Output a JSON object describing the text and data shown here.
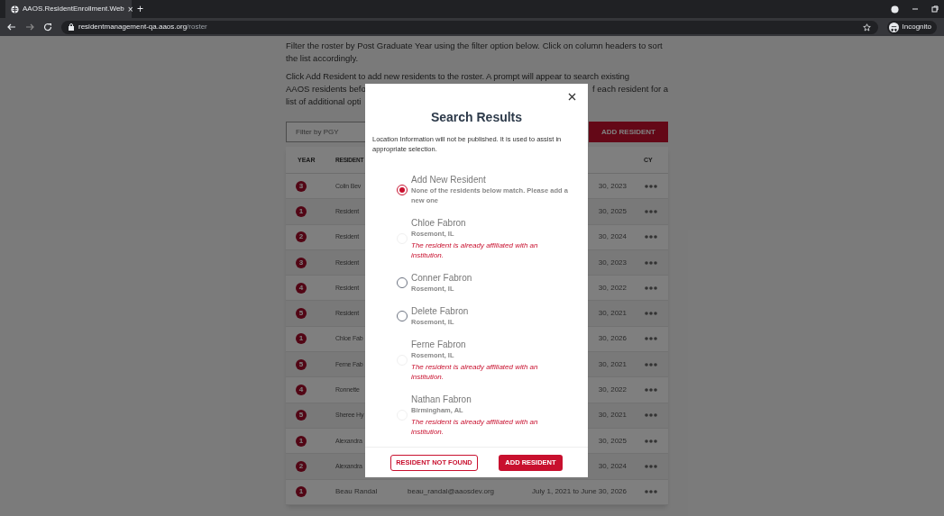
{
  "browser": {
    "tab_title": "AAOS.ResidentEnrollment.Web",
    "tab_close": "×",
    "new_tab": "+",
    "url_host": "residentmanagement-qa.aaos.org",
    "url_path": "/roster",
    "profile": "Incognito"
  },
  "intro": [
    "Filter the roster by Post Graduate Year using the filter option below. Click on column headers to sort the list accordingly.",
    "Click Add Resident to add new residents to the roster. A prompt will appear to search existing"
  ],
  "intro_cut": [
    {
      "left": "AAOS residents befo",
      "right": "f each resident for a"
    },
    {
      "left": "list of additional opti"
    }
  ],
  "filter": {
    "placeholder": "Filter by PGY"
  },
  "add_button": "ADD RESIDENT",
  "table": {
    "columns": [
      "YEAR",
      "RESIDENT",
      "CY"
    ],
    "rows": [
      {
        "year": "3",
        "name": "Colin Bev",
        "dates": "30, 2023"
      },
      {
        "year": "1",
        "name": "Resident",
        "dates": "30, 2025"
      },
      {
        "year": "2",
        "name": "Resident",
        "dates": "30, 2024"
      },
      {
        "year": "3",
        "name": "Resident",
        "dates": "30, 2023"
      },
      {
        "year": "4",
        "name": "Resident",
        "dates": "30, 2022"
      },
      {
        "year": "5",
        "name": "Resident",
        "dates": "30, 2021"
      },
      {
        "year": "1",
        "name": "Chloe Fab",
        "dates": "30, 2026"
      },
      {
        "year": "5",
        "name": "Ferne Fab",
        "dates": "30, 2021"
      },
      {
        "year": "4",
        "name": "Ronnette",
        "dates": "30, 2022"
      },
      {
        "year": "5",
        "name": "Sheree Hy",
        "dates": "30, 2021"
      },
      {
        "year": "1",
        "name": "Alexandra",
        "dates": "30, 2025"
      },
      {
        "year": "2",
        "name": "Alexandra",
        "dates": "30, 2024"
      },
      {
        "year": "1",
        "name": "Beau Randal",
        "email": "beau_randal@aaosdev.org",
        "dates": "July 1, 2021 to June 30, 2026"
      }
    ]
  },
  "modal": {
    "title": "Search Results",
    "info": "Location Information will not be published. It is used to assist in appropriate selection.",
    "options": [
      {
        "name": "Add New Resident",
        "detail": "None of the residents below match. Please add a new one",
        "selected": true,
        "disabled": false
      },
      {
        "name": "Chloe Fabron",
        "detail": "Rosemont, IL",
        "warning": "The resident is already affiliated with an institution.",
        "selected": false,
        "disabled": true
      },
      {
        "name": "Conner Fabron",
        "detail": "Rosemont, IL",
        "selected": false,
        "disabled": false
      },
      {
        "name": "Delete Fabron",
        "detail": "Rosemont, IL",
        "selected": false,
        "disabled": false
      },
      {
        "name": "Ferne Fabron",
        "detail": "Rosemont, IL",
        "warning": "The resident is already affiliated with an institution.",
        "selected": false,
        "disabled": true
      },
      {
        "name": "Nathan Fabron",
        "detail": "Birmingham, AL",
        "warning": "The resident is already affiliated with an institution.",
        "selected": false,
        "disabled": true
      }
    ],
    "buttons": [
      {
        "label": "RESIDENT NOT FOUND",
        "kind": "outline"
      },
      {
        "label": "ADD RESIDENT",
        "kind": "primary"
      }
    ]
  }
}
